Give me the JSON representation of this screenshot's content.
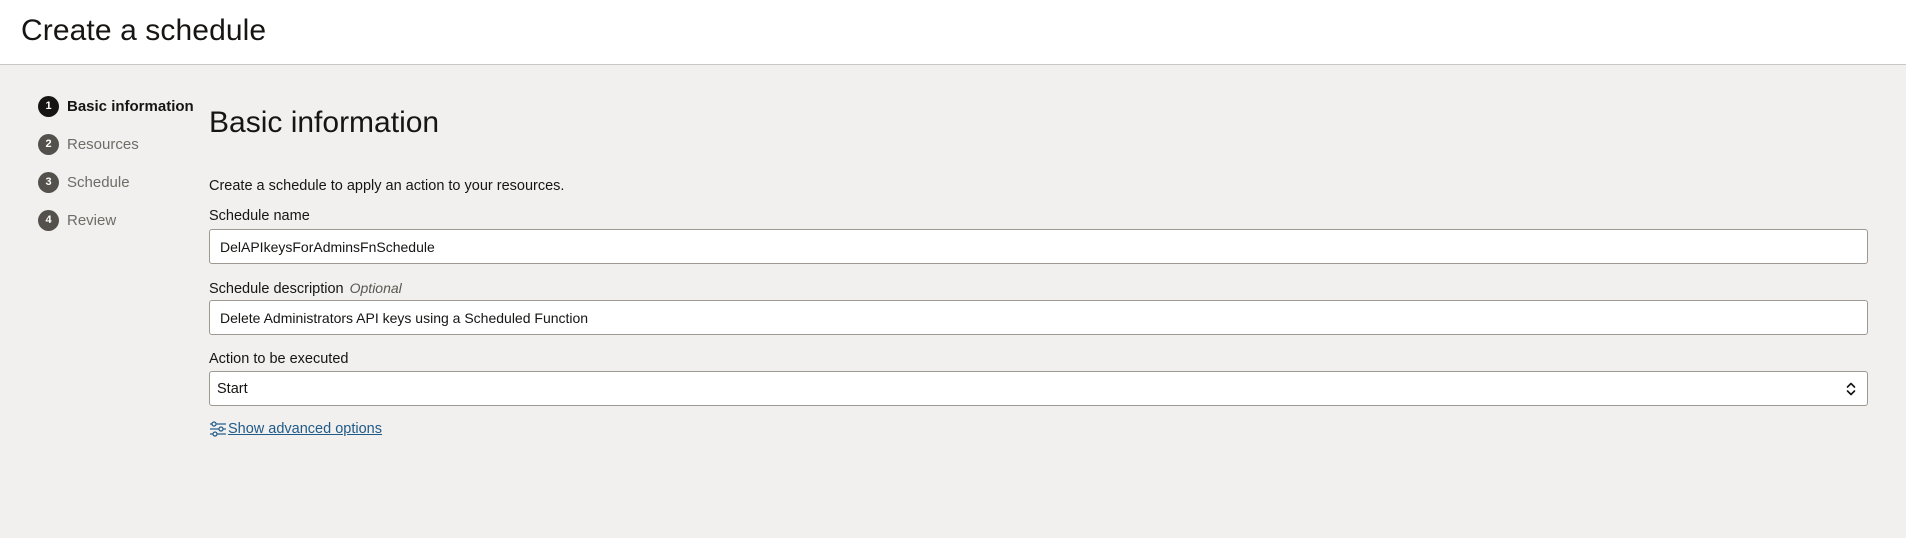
{
  "page": {
    "title": "Create a schedule"
  },
  "steps": [
    {
      "number": "1",
      "label": "Basic information",
      "active": true
    },
    {
      "number": "2",
      "label": "Resources",
      "active": false
    },
    {
      "number": "3",
      "label": "Schedule",
      "active": false
    },
    {
      "number": "4",
      "label": "Review",
      "active": false
    }
  ],
  "form": {
    "section_title": "Basic information",
    "intro": "Create a schedule to apply an action to your resources.",
    "schedule_name": {
      "label": "Schedule name",
      "value": "DelAPIkeysForAdminsFnSchedule"
    },
    "schedule_description": {
      "label": "Schedule description",
      "optional": "Optional",
      "value": "Delete Administrators API keys using a Scheduled Function"
    },
    "action": {
      "label": "Action to be executed",
      "value": "Start"
    },
    "advanced_link": "Show advanced options"
  },
  "colors": {
    "background": "#f1f0ee",
    "header": "#ffffff",
    "link": "#1f5a89",
    "active_step": "#161513",
    "inactive_step": "#54504c"
  },
  "icons": {
    "advanced": "sliders-icon",
    "select": "chevron-up-down-icon"
  }
}
